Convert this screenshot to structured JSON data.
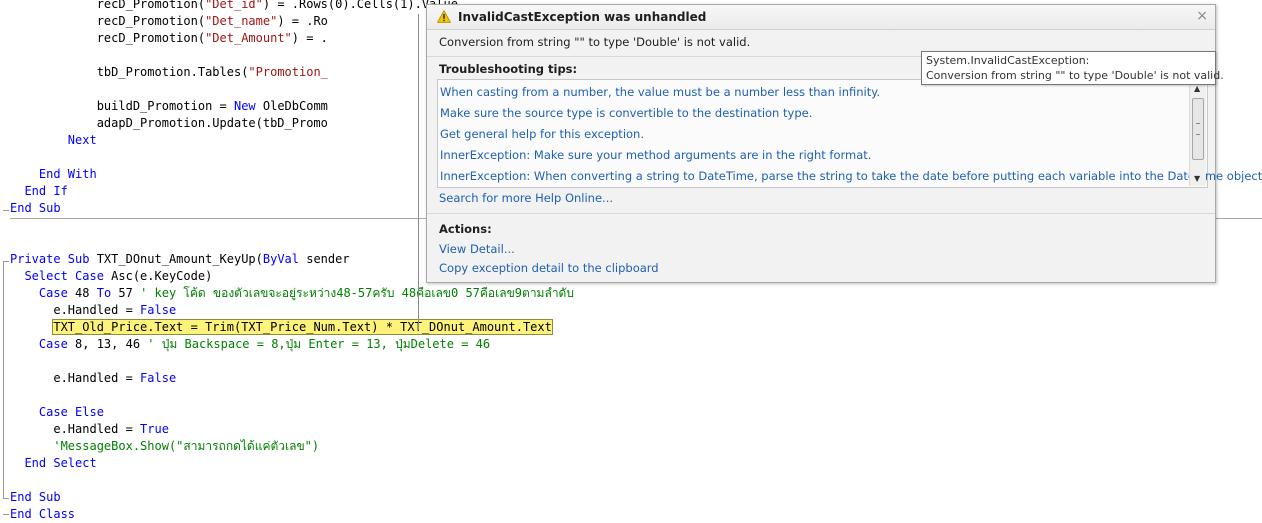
{
  "code": {
    "lines": [
      {
        "segs": [
          [
            "",
            "            recD_Promotion("
          ],
          [
            "str",
            "\"Det_id\""
          ],
          [
            "",
            ") = .Rows(0).Cells(1).Value"
          ]
        ]
      },
      {
        "segs": [
          [
            "",
            "            recD_Promotion("
          ],
          [
            "str",
            "\"Det_name\""
          ],
          [
            "",
            ") = .Ro"
          ]
        ]
      },
      {
        "segs": [
          [
            "",
            "            recD_Promotion("
          ],
          [
            "str",
            "\"Det_Amount\""
          ],
          [
            "",
            ") = ."
          ]
        ]
      },
      {
        "segs": [
          [
            "",
            ""
          ]
        ]
      },
      {
        "segs": [
          [
            "",
            "            tbD_Promotion.Tables("
          ],
          [
            "str",
            "\"Promotion_"
          ]
        ]
      },
      {
        "segs": [
          [
            "",
            ""
          ]
        ]
      },
      {
        "segs": [
          [
            "",
            "            buildD_Promotion = "
          ],
          [
            "kw",
            "New"
          ],
          [
            "",
            " OleDbComm"
          ]
        ]
      },
      {
        "segs": [
          [
            "",
            "            adapD_Promotion.Update(tbD_Promo"
          ]
        ]
      },
      {
        "segs": [
          [
            "",
            "        "
          ],
          [
            "kw",
            "Next"
          ]
        ]
      },
      {
        "segs": [
          [
            "",
            ""
          ]
        ]
      },
      {
        "segs": [
          [
            "",
            "    "
          ],
          [
            "kw",
            "End With"
          ]
        ]
      },
      {
        "segs": [
          [
            "",
            "  "
          ],
          [
            "kw",
            "End If"
          ]
        ]
      },
      {
        "segs": [
          [
            "kw",
            "End Sub"
          ]
        ]
      },
      {
        "segs": [
          [
            "",
            ""
          ]
        ]
      },
      {
        "segs": [
          [
            "",
            ""
          ]
        ]
      },
      {
        "segs": [
          [
            "kw",
            "Private Sub"
          ],
          [
            "",
            " TXT_DOnut_Amount_KeyUp("
          ],
          [
            "kw",
            "ByVal"
          ],
          [
            "",
            " sender"
          ]
        ]
      },
      {
        "segs": [
          [
            "",
            "  "
          ],
          [
            "kw",
            "Select Case"
          ],
          [
            "",
            " Asc(e.KeyCode)"
          ]
        ]
      },
      {
        "segs": [
          [
            "",
            "    "
          ],
          [
            "kw",
            "Case"
          ],
          [
            "",
            " 48 "
          ],
          [
            "kw",
            "To"
          ],
          [
            "",
            " 57 "
          ],
          [
            "cm",
            "' key โค้ด ของตัวเลขจะอยู่ระหว่าง48-57ครับ 48คือเลข0 57คือเลข9ตามลำดับ"
          ]
        ]
      },
      {
        "segs": [
          [
            "",
            "      e.Handled = "
          ],
          [
            "kw",
            "False"
          ]
        ]
      },
      {
        "segs": [
          [
            "",
            "      "
          ],
          [
            "hl",
            "TXT_Old_Price.Text = Trim(TXT_Price_Num.Text) * TXT_DOnut_Amount.Text"
          ]
        ]
      },
      {
        "segs": [
          [
            "",
            "    "
          ],
          [
            "kw",
            "Case"
          ],
          [
            "",
            " 8, 13, 46 "
          ],
          [
            "cm",
            "' ปุ่ม Backspace = 8,ปุ่ม Enter = 13, ปุ่มDelete = 46"
          ]
        ]
      },
      {
        "segs": [
          [
            "",
            ""
          ]
        ]
      },
      {
        "segs": [
          [
            "",
            "      e.Handled = "
          ],
          [
            "kw",
            "False"
          ]
        ]
      },
      {
        "segs": [
          [
            "",
            ""
          ]
        ]
      },
      {
        "segs": [
          [
            "",
            "    "
          ],
          [
            "kw",
            "Case Else"
          ]
        ]
      },
      {
        "segs": [
          [
            "",
            "      e.Handled = "
          ],
          [
            "kw",
            "True"
          ]
        ]
      },
      {
        "segs": [
          [
            "",
            "      "
          ],
          [
            "cm",
            "'MessageBox.Show(\"สามารถกดได้แค่ตัวเลข\")"
          ]
        ]
      },
      {
        "segs": [
          [
            "",
            "  "
          ],
          [
            "kw",
            "End Select"
          ]
        ]
      },
      {
        "segs": [
          [
            "",
            ""
          ]
        ]
      },
      {
        "segs": [
          [
            "kw",
            "End Sub"
          ]
        ]
      },
      {
        "segs": [
          [
            "kw",
            "End Class"
          ]
        ]
      }
    ]
  },
  "exception": {
    "title": "InvalidCastException was unhandled",
    "close_icon": "×",
    "message": "Conversion from string \"\" to type 'Double' is not valid.",
    "tips_heading": "Troubleshooting tips:",
    "tips": [
      "When casting from a number, the value must be a number less than infinity.",
      "Make sure the source type is convertible to the destination type.",
      "Get general help for this exception.",
      "InnerException: Make sure your method arguments are in the right format.",
      "InnerException: When converting a string to DateTime, parse the string to take the date before putting each variable into the DateTime object."
    ],
    "search_link": "Search for more Help Online...",
    "actions_heading": "Actions:",
    "actions": [
      "View Detail...",
      "Copy exception detail to the clipboard"
    ]
  },
  "tooltip": {
    "line1": "System.InvalidCastException:",
    "line2": "Conversion from string \"\" to type 'Double' is not valid."
  },
  "icons": [
    "warning-icon",
    "close-icon",
    "scroll-up-icon",
    "scroll-down-icon"
  ],
  "colors": {
    "keyword": "#0000ff",
    "string": "#a31515",
    "comment": "#008000",
    "highlight": "#fdf27a",
    "link": "#1e5fb4"
  }
}
